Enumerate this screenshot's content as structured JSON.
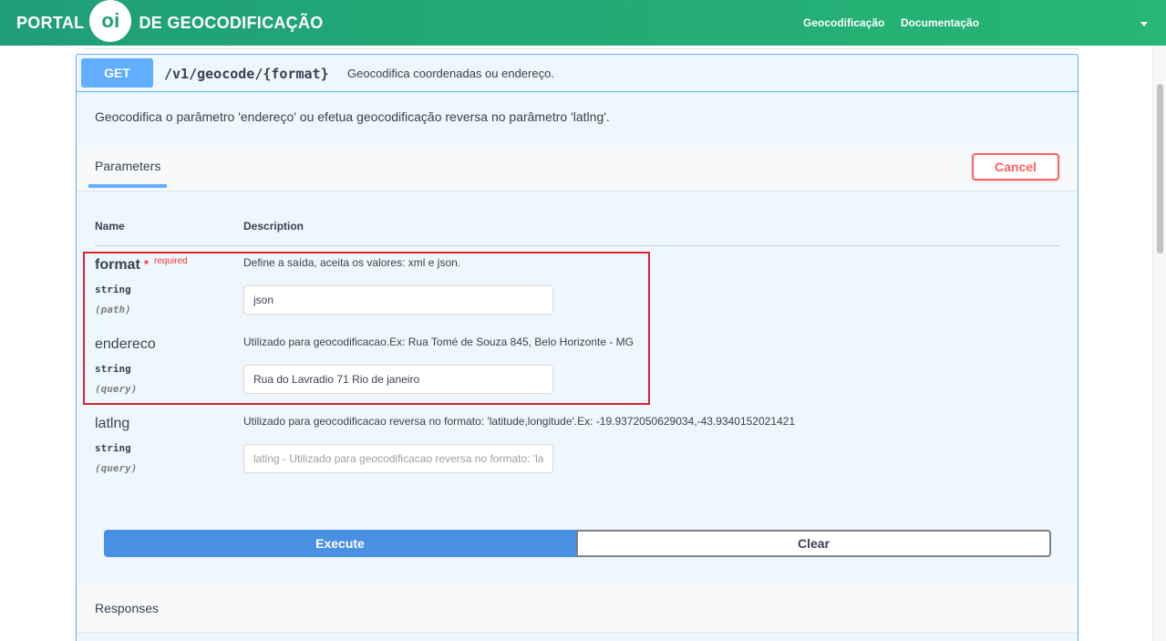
{
  "header": {
    "brand_left": "PORTAL",
    "brand_logo": "oi",
    "brand_right": "DE GEOCODIFICAÇÃO",
    "nav": [
      {
        "label": "Geocodificação"
      },
      {
        "label": "Documentação"
      }
    ],
    "menu_caret_icon": "chevron-down-icon"
  },
  "operation": {
    "method": "GET",
    "path": "/v1/geocode/{format}",
    "summary": "Geocodifica coordenadas ou endereço.",
    "description": "Geocodifica o parâmetro 'endereço' ou efetua geocodificação reversa no parâmetro 'latlng'."
  },
  "parameters_section": {
    "tab_label": "Parameters",
    "cancel_label": "Cancel",
    "col_name": "Name",
    "col_description": "Description",
    "params": [
      {
        "name": "format",
        "required_star": "*",
        "required_label": "required",
        "type": "string",
        "in": "(path)",
        "description": "Define a saída, aceita os valores: xml e json.",
        "value": "json",
        "placeholder": ""
      },
      {
        "name": "endereco",
        "type": "string",
        "in": "(query)",
        "description": "Utilizado para geocodificacao.Ex: Rua Tomé de Souza 845, Belo Horizonte - MG",
        "value": "Rua do Lavradio 71 Rio de janeiro",
        "placeholder": ""
      },
      {
        "name": "latlng",
        "type": "string",
        "in": "(query)",
        "description": "Utilizado para geocodificacao reversa no formato: 'latitude,longitude'.Ex: -19.9372050629034,-43.9340152021421",
        "value": "",
        "placeholder": "latlng - Utilizado para geocodificacao reversa no formato: 'latitude,longitude'"
      }
    ],
    "execute_label": "Execute",
    "clear_label": "Clear"
  },
  "responses": {
    "label": "Responses"
  },
  "colors": {
    "header_green": "#1f9e78",
    "get_blue": "#61affe",
    "execute_blue": "#4990e2",
    "cancel_red": "#ff6060",
    "highlight_red": "#d9262c"
  }
}
